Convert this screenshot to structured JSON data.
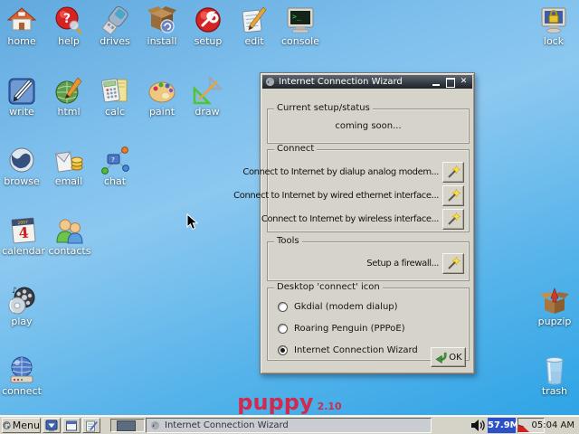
{
  "desktop": {
    "icons": [
      {
        "label": "home"
      },
      {
        "label": "help"
      },
      {
        "label": "drives"
      },
      {
        "label": "install"
      },
      {
        "label": "setup"
      },
      {
        "label": "edit"
      },
      {
        "label": "console"
      },
      {
        "label": "lock"
      },
      {
        "label": "write"
      },
      {
        "label": "html"
      },
      {
        "label": "calc"
      },
      {
        "label": "paint"
      },
      {
        "label": "draw"
      },
      {
        "label": "browse"
      },
      {
        "label": "email"
      },
      {
        "label": "chat"
      },
      {
        "label": "calendar"
      },
      {
        "label": "contacts"
      },
      {
        "label": "play"
      },
      {
        "label": "pupzip"
      },
      {
        "label": "connect"
      },
      {
        "label": "trash"
      }
    ],
    "brand": {
      "name": "puppy",
      "version": "2.10",
      "color": "#d02a4e"
    }
  },
  "window": {
    "title": "Internet Connection Wizard",
    "groups": {
      "status": {
        "label": "Current setup/status",
        "content": "coming soon..."
      },
      "connect": {
        "label": "Connect",
        "items": [
          "Connect to Internet by dialup analog modem...",
          "Connect to Internet by wired ethernet interface...",
          "Connect to Internet by wireless interface..."
        ]
      },
      "tools": {
        "label": "Tools",
        "items": [
          "Setup a firewall..."
        ]
      },
      "desktop_icon": {
        "label": "Desktop 'connect' icon",
        "options": [
          {
            "label": "Gkdial (modem dialup)",
            "selected": false
          },
          {
            "label": "Roaring Penguin (PPPoE)",
            "selected": false
          },
          {
            "label": "Internet Connection Wizard",
            "selected": true
          }
        ]
      }
    },
    "ok_label": "OK"
  },
  "taskbar": {
    "menu_label": "Menu",
    "task": {
      "title": "Internet Connection Wizard"
    },
    "memory": "57.9M",
    "clock": "05:04 AM"
  },
  "icons": {
    "close": "✕"
  },
  "colors": {
    "accent_blue": "#2b50c8",
    "brand_red": "#d02a4e",
    "titlebar_dark": "#343b42"
  }
}
